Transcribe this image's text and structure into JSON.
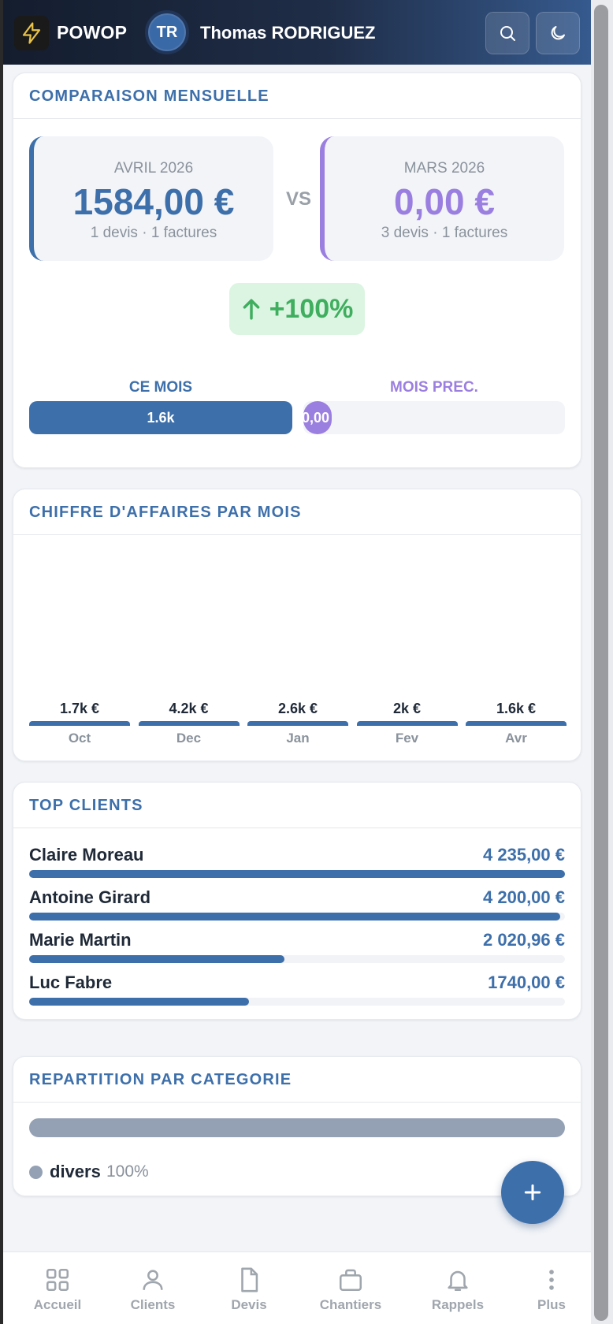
{
  "header": {
    "brand": "POWOP",
    "avatar_initials": "TR",
    "user_name": "Thomas RODRIGUEZ",
    "search_icon": "search-icon",
    "theme_icon": "moon-icon",
    "logo_icon": "lightning-icon"
  },
  "comparison": {
    "title": "COMPARAISON MENSUELLE",
    "current": {
      "month": "AVRIL 2026",
      "amount": "1584,00 €",
      "details": "1 devis · 1 factures"
    },
    "vs": "VS",
    "previous": {
      "month": "MARS 2026",
      "amount": "0,00 €",
      "details": "3 devis · 1 factures"
    },
    "change": "+100%",
    "this_month_label": "CE MOIS",
    "prev_month_label": "MOIS PREC.",
    "this_month_bar_value": "1.6k",
    "prev_month_bar_value": "0,00",
    "colors": {
      "current": "#3d6faa",
      "previous": "#9b7fe0",
      "positive": "#3fae5e"
    }
  },
  "revenue": {
    "title": "CHIFFRE D'AFFAIRES PAR MOIS"
  },
  "chart_data": {
    "type": "bar",
    "categories": [
      "Oct",
      "Dec",
      "Jan",
      "Fev",
      "Avr"
    ],
    "values": [
      1700,
      4200,
      2600,
      2000,
      1600
    ],
    "data_labels": [
      "1.7k €",
      "4.2k €",
      "2.6k €",
      "2k €",
      "1.6k €"
    ]
  },
  "top_clients": {
    "title": "TOP CLIENTS",
    "items": [
      {
        "name": "Claire Moreau",
        "amount": "4 235,00 €",
        "value": 4235.0
      },
      {
        "name": "Antoine Girard",
        "amount": "4 200,00 €",
        "value": 4200.0
      },
      {
        "name": "Marie Martin",
        "amount": "2 020,96 €",
        "value": 2020.96
      },
      {
        "name": "Luc Fabre",
        "amount": "1740,00 €",
        "value": 1740.0
      }
    ]
  },
  "categories": {
    "title": "REPARTITION PAR CATEGORIE",
    "items": [
      {
        "name": "divers",
        "percent": "100%",
        "color": "#94a1b4"
      }
    ]
  },
  "fab": {
    "icon": "plus-icon"
  },
  "nav": {
    "items": [
      {
        "label": "Accueil",
        "icon": "grid-icon"
      },
      {
        "label": "Clients",
        "icon": "user-icon"
      },
      {
        "label": "Devis",
        "icon": "document-icon"
      },
      {
        "label": "Chantiers",
        "icon": "briefcase-icon"
      },
      {
        "label": "Rappels",
        "icon": "bell-icon"
      },
      {
        "label": "Plus",
        "icon": "more-vertical-icon"
      }
    ]
  }
}
